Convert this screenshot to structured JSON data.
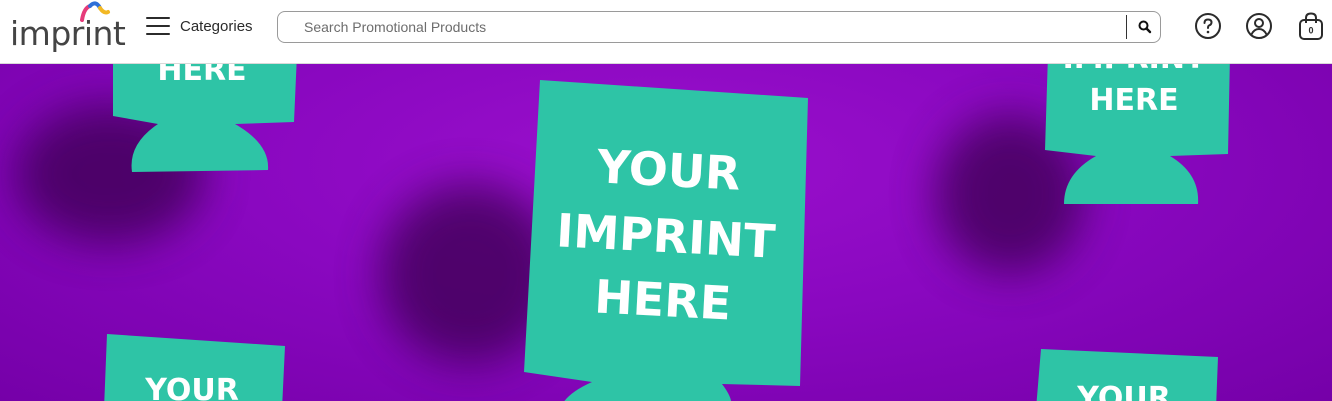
{
  "header": {
    "logo_text": "imprint",
    "menu_label": "Categories",
    "search_placeholder": "Search Promotional Products",
    "cart_count": "0"
  },
  "hero": {
    "koozie_main": [
      "YOUR",
      "IMPRINT",
      "HERE"
    ],
    "koozie_top_left": "HERE",
    "koozie_top_right": [
      "IMPRINT",
      "HERE"
    ],
    "koozie_bottom_left": "YOUR",
    "koozie_bottom_right": "YOUR",
    "colors": {
      "background": "#8a08c0",
      "koozie": "#2ec4a6"
    }
  },
  "icons": [
    "hamburger-icon",
    "search-icon",
    "help-icon",
    "account-icon",
    "cart-icon"
  ]
}
